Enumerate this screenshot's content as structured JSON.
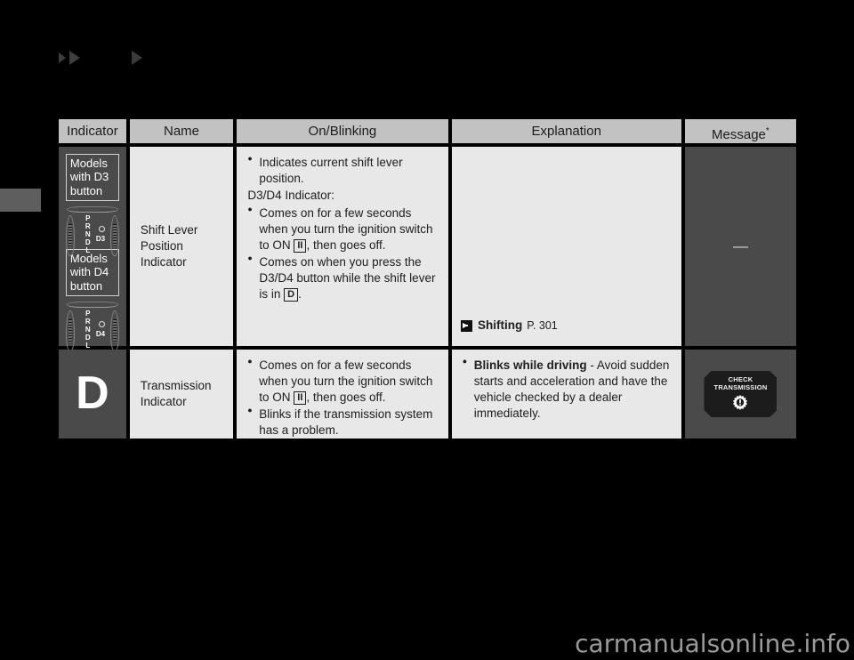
{
  "page": {
    "background_color": "#000000",
    "watermark": "carmanualsonline.info"
  },
  "markers": {
    "arrow_1": "double-right-triangle-marker",
    "arrow_2": "right-triangle-marker"
  },
  "side_tab": {
    "color": "#5e5e5e"
  },
  "table": {
    "headers": [
      {
        "label": "Indicator"
      },
      {
        "label": "Name"
      },
      {
        "label": "On/Blinking"
      },
      {
        "label": "Explanation"
      },
      {
        "label": "Message",
        "superscript": "*"
      }
    ],
    "rows": [
      {
        "indicator": {
          "type": "shift-lever-graphic",
          "variants": [
            {
              "badge": "Models with D3 button",
              "badge_lines": [
                "Models",
                "with D3",
                "button"
              ],
              "gate_letters": [
                "P",
                "R",
                "N",
                "D",
                "L"
              ],
              "gate_button_label": "D3"
            },
            {
              "badge": "Models with D4 button",
              "badge_lines": [
                "Models",
                "with D4",
                "button"
              ],
              "gate_letters": [
                "P",
                "R",
                "N",
                "D",
                "L"
              ],
              "gate_button_label": "D4"
            }
          ]
        },
        "name": "Shift Lever Position Indicator",
        "name_lines": [
          "Shift Lever",
          "Position Indicator"
        ],
        "on_blinking": {
          "items": [
            {
              "kind": "bullet",
              "text": "Indicates current shift lever position."
            },
            {
              "kind": "plain",
              "text": "D3/D4 Indicator:"
            },
            {
              "kind": "bullet",
              "text_before": "Comes on for a few seconds when you turn the ignition switch to ON ",
              "symbol": "II",
              "text_after": ", then goes off."
            },
            {
              "kind": "bullet",
              "text_before": "Comes on when you press the D3/D4 button while the shift lever is in ",
              "symbol": "D",
              "text_after": "."
            }
          ]
        },
        "explanation": {
          "link_icon": "arrow-reference-icon",
          "link_title": "Shifting",
          "link_page": "P. 301"
        },
        "message": {
          "type": "dash",
          "value": "—"
        }
      },
      {
        "indicator": {
          "type": "letter-glyph",
          "glyph": "D"
        },
        "name": "Transmission Indicator",
        "name_lines": [
          "Transmission",
          "Indicator"
        ],
        "on_blinking": {
          "items": [
            {
              "kind": "bullet",
              "text_before": "Comes on for a few seconds when you turn the ignition switch to ON ",
              "symbol": "II",
              "text_after": ", then goes off."
            },
            {
              "kind": "bullet",
              "text": "Blinks if the transmission system has a problem."
            }
          ]
        },
        "explanation": {
          "items": [
            {
              "kind": "bullet",
              "bold": "Blinks while driving",
              "text": " - Avoid sudden starts and acceleration and have the vehicle checked by a dealer immediately."
            }
          ]
        },
        "message": {
          "type": "telltale",
          "telltale_lines": [
            "CHECK",
            "TRANSMISSION"
          ],
          "telltale_icon": "gear-warning-icon"
        }
      }
    ]
  },
  "colors": {
    "header_bg": "#c2c2c2",
    "body_bg": "#e8e8e8",
    "dark_cell_bg": "#4a4a4a",
    "page_bg": "#000000",
    "telltale_bg": "#1c1c1c"
  }
}
